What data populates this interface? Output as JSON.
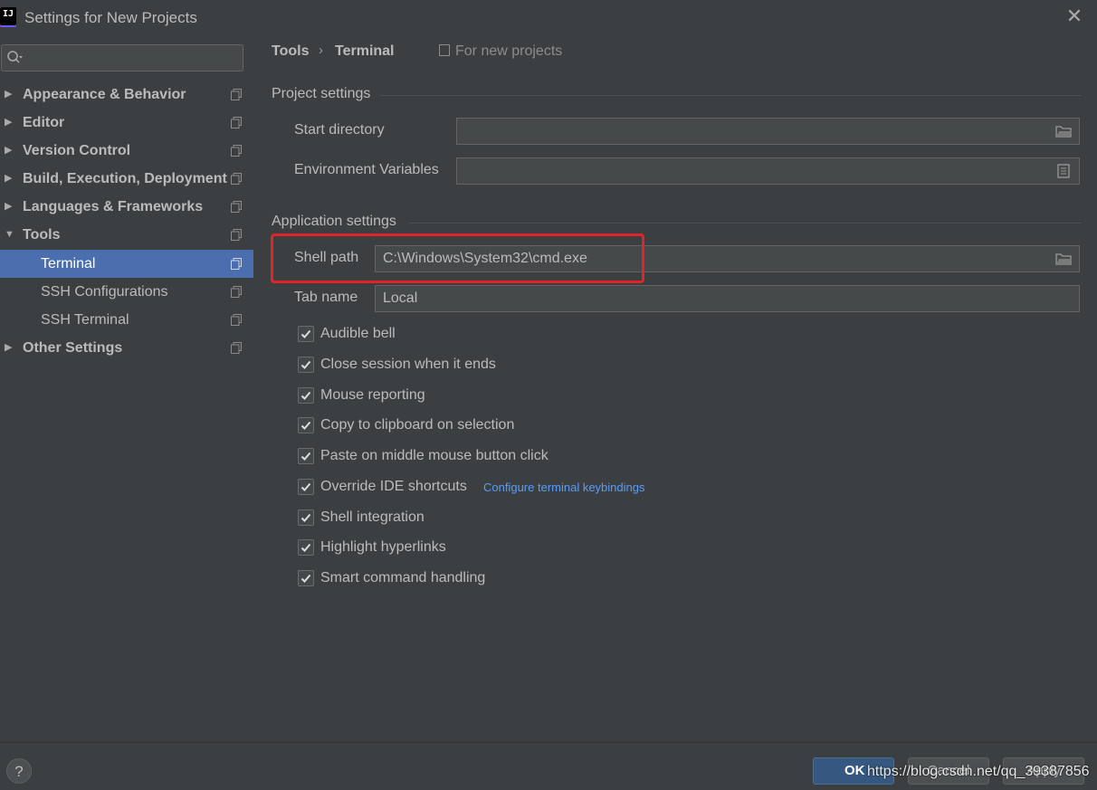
{
  "window": {
    "title": "Settings for New Projects",
    "app_icon_text": "IJ"
  },
  "sidebar": {
    "search_placeholder": "",
    "items": [
      {
        "label": "Appearance & Behavior",
        "expanded": false,
        "bold": true
      },
      {
        "label": "Editor",
        "expanded": false,
        "bold": true
      },
      {
        "label": "Version Control",
        "expanded": false,
        "bold": true
      },
      {
        "label": "Build, Execution, Deployment",
        "expanded": false,
        "bold": true
      },
      {
        "label": "Languages & Frameworks",
        "expanded": false,
        "bold": true
      },
      {
        "label": "Tools",
        "expanded": true,
        "bold": true
      },
      {
        "label": "Terminal",
        "selected": true
      },
      {
        "label": "SSH Configurations"
      },
      {
        "label": "SSH Terminal"
      },
      {
        "label": "Other Settings",
        "expanded": false,
        "bold": true
      }
    ]
  },
  "breadcrumb": {
    "parent": "Tools",
    "separator": "›",
    "current": "Terminal",
    "scope": "For new projects"
  },
  "project_settings": {
    "title": "Project settings",
    "start_directory_label": "Start directory",
    "start_directory_value": "",
    "env_vars_label": "Environment Variables",
    "env_vars_value": ""
  },
  "application_settings": {
    "title": "Application settings",
    "shell_path_label": "Shell path",
    "shell_path_value": "C:\\Windows\\System32\\cmd.exe",
    "tab_name_label": "Tab name",
    "tab_name_value": "Local",
    "options": [
      {
        "label": "Audible bell",
        "checked": true
      },
      {
        "label": "Close session when it ends",
        "checked": true
      },
      {
        "label": "Mouse reporting",
        "checked": true
      },
      {
        "label": "Copy to clipboard on selection",
        "checked": true
      },
      {
        "label": "Paste on middle mouse button click",
        "checked": true
      },
      {
        "label": "Override IDE shortcuts",
        "checked": true
      },
      {
        "label": "Shell integration",
        "checked": true
      },
      {
        "label": "Highlight hyperlinks",
        "checked": true
      },
      {
        "label": "Smart command handling",
        "checked": true
      }
    ],
    "keybindings_link": "Configure terminal keybindings"
  },
  "footer": {
    "help_label": "?",
    "ok_label": "OK",
    "cancel_label": "Cancel",
    "apply_label": "Apply",
    "watermark": "https://blog.csdn.net/qq_39387856"
  },
  "colors": {
    "background": "#3c3f41",
    "selection": "#4b6eaf",
    "link": "#589df6",
    "annotation_box": "#e0242a"
  }
}
